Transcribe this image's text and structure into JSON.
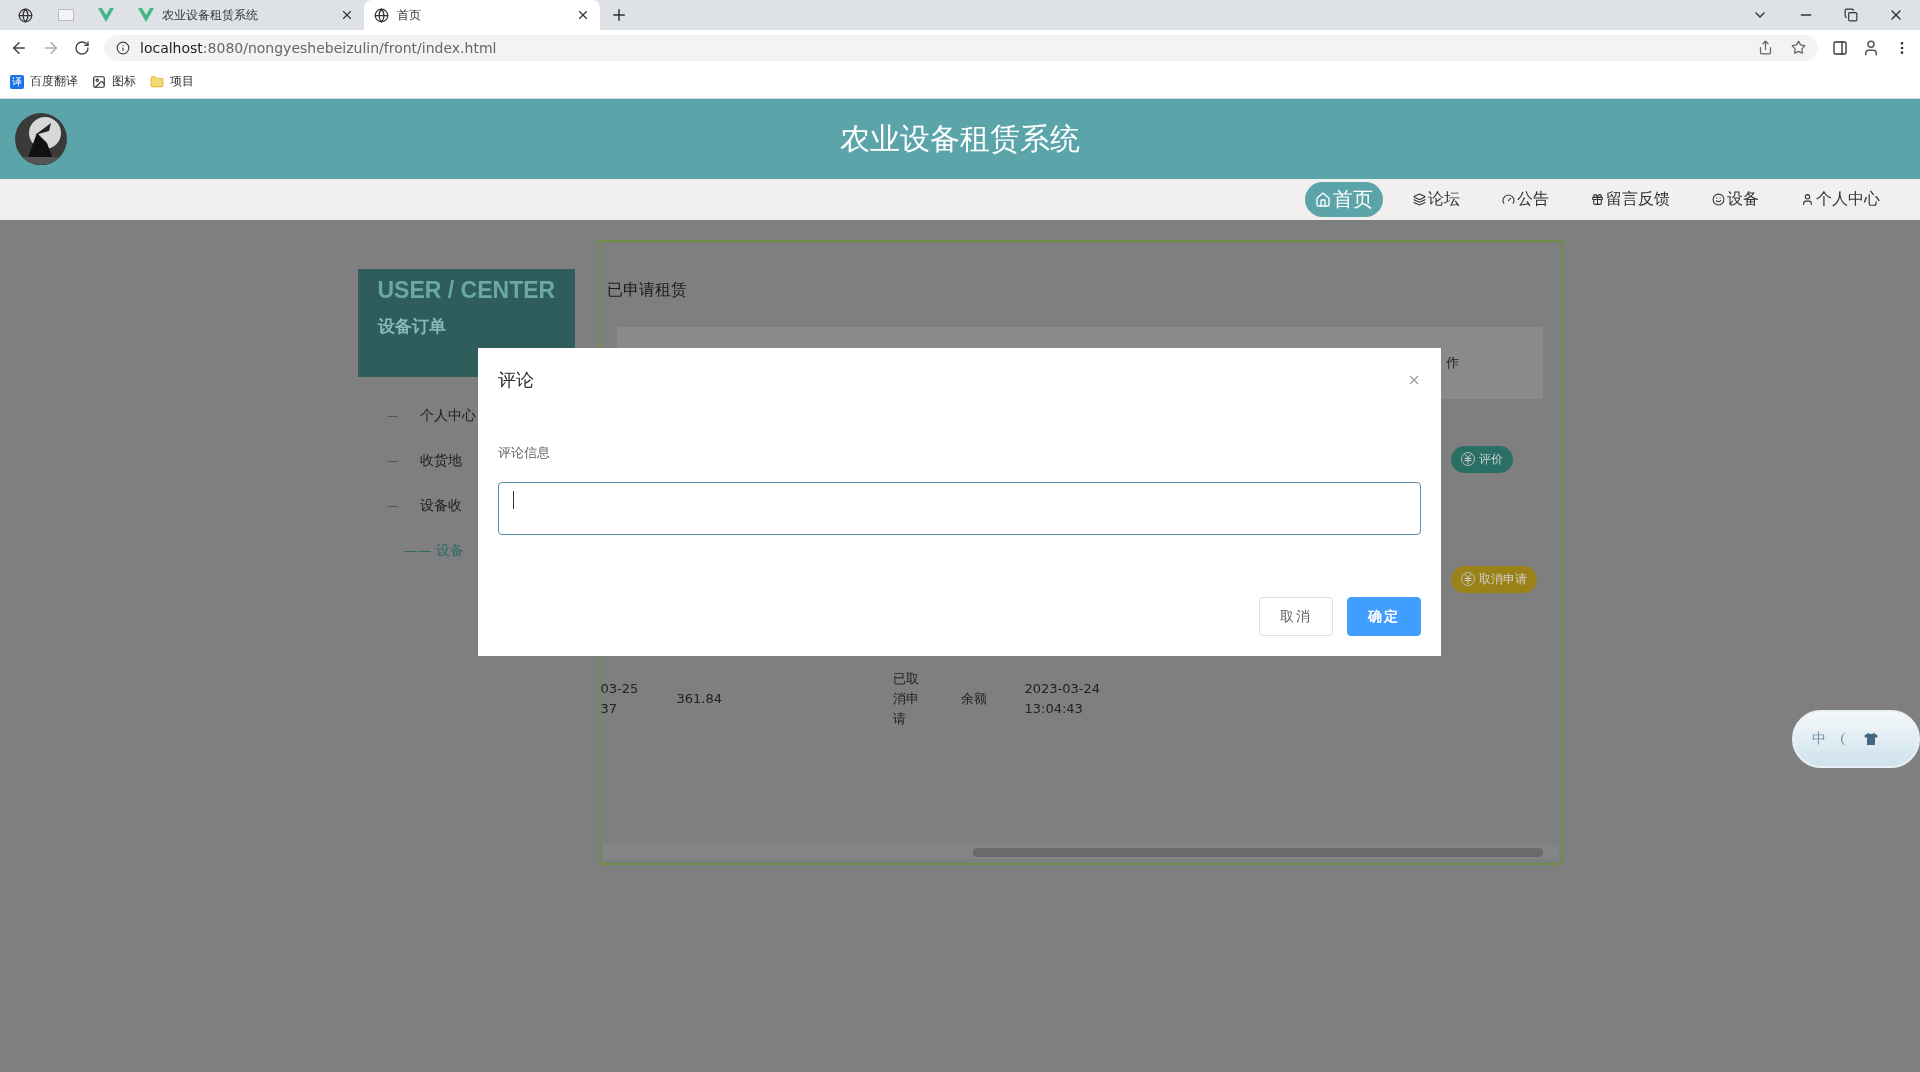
{
  "browser": {
    "tabs": [
      {
        "kind": "icon",
        "selected": false
      },
      {
        "kind": "icon",
        "selected": false
      },
      {
        "kind": "icon",
        "selected": false
      },
      {
        "kind": "titled",
        "title": "农业设备租赁系统",
        "selected": false
      },
      {
        "kind": "titled",
        "title": "首页",
        "selected": true
      }
    ],
    "url": {
      "host": "localhost",
      "rest": ":8080/nongyeshebeizulin/front/index.html"
    },
    "bookmarks": [
      {
        "label": "百度翻译",
        "favicon": "译"
      },
      {
        "label": "图标"
      },
      {
        "label": "项目"
      }
    ]
  },
  "site": {
    "title": "农业设备租赁系统",
    "nav": [
      {
        "label": "首页",
        "selected": true
      },
      {
        "label": "论坛",
        "selected": false
      },
      {
        "label": "公告",
        "selected": false
      },
      {
        "label": "留言反馈",
        "selected": false
      },
      {
        "label": "设备",
        "selected": false
      },
      {
        "label": "个人中心",
        "selected": false
      }
    ]
  },
  "user_center": {
    "heading": "USER / CENTER",
    "subtitle": "设备订单",
    "menu": [
      {
        "label": "个人中心",
        "selected": false
      },
      {
        "label": "收货地",
        "selected": false
      },
      {
        "label": "设备收",
        "selected": false
      },
      {
        "label": "—— 设备",
        "selected": true
      }
    ]
  },
  "orders": {
    "title": "已申请租赁",
    "last_column": "作",
    "rows": [
      {
        "kind": "action",
        "action": {
          "label": "评价",
          "kind": "review"
        }
      },
      {
        "kind": "action",
        "action": {
          "label": "取消申请",
          "kind": "cancel"
        }
      },
      {
        "kind": "cells",
        "cells": [
          "03-25\n37",
          "361.84",
          "已取消申请",
          "余额",
          "2023-03-24\n13:04:43"
        ]
      }
    ]
  },
  "dialog": {
    "title": "评论",
    "field_label": "评论信息",
    "buttons": [
      {
        "label": "取消",
        "kind": "secondary"
      },
      {
        "label": "确定",
        "kind": "primary"
      }
    ]
  },
  "ime_widget": {
    "label": "中"
  }
}
